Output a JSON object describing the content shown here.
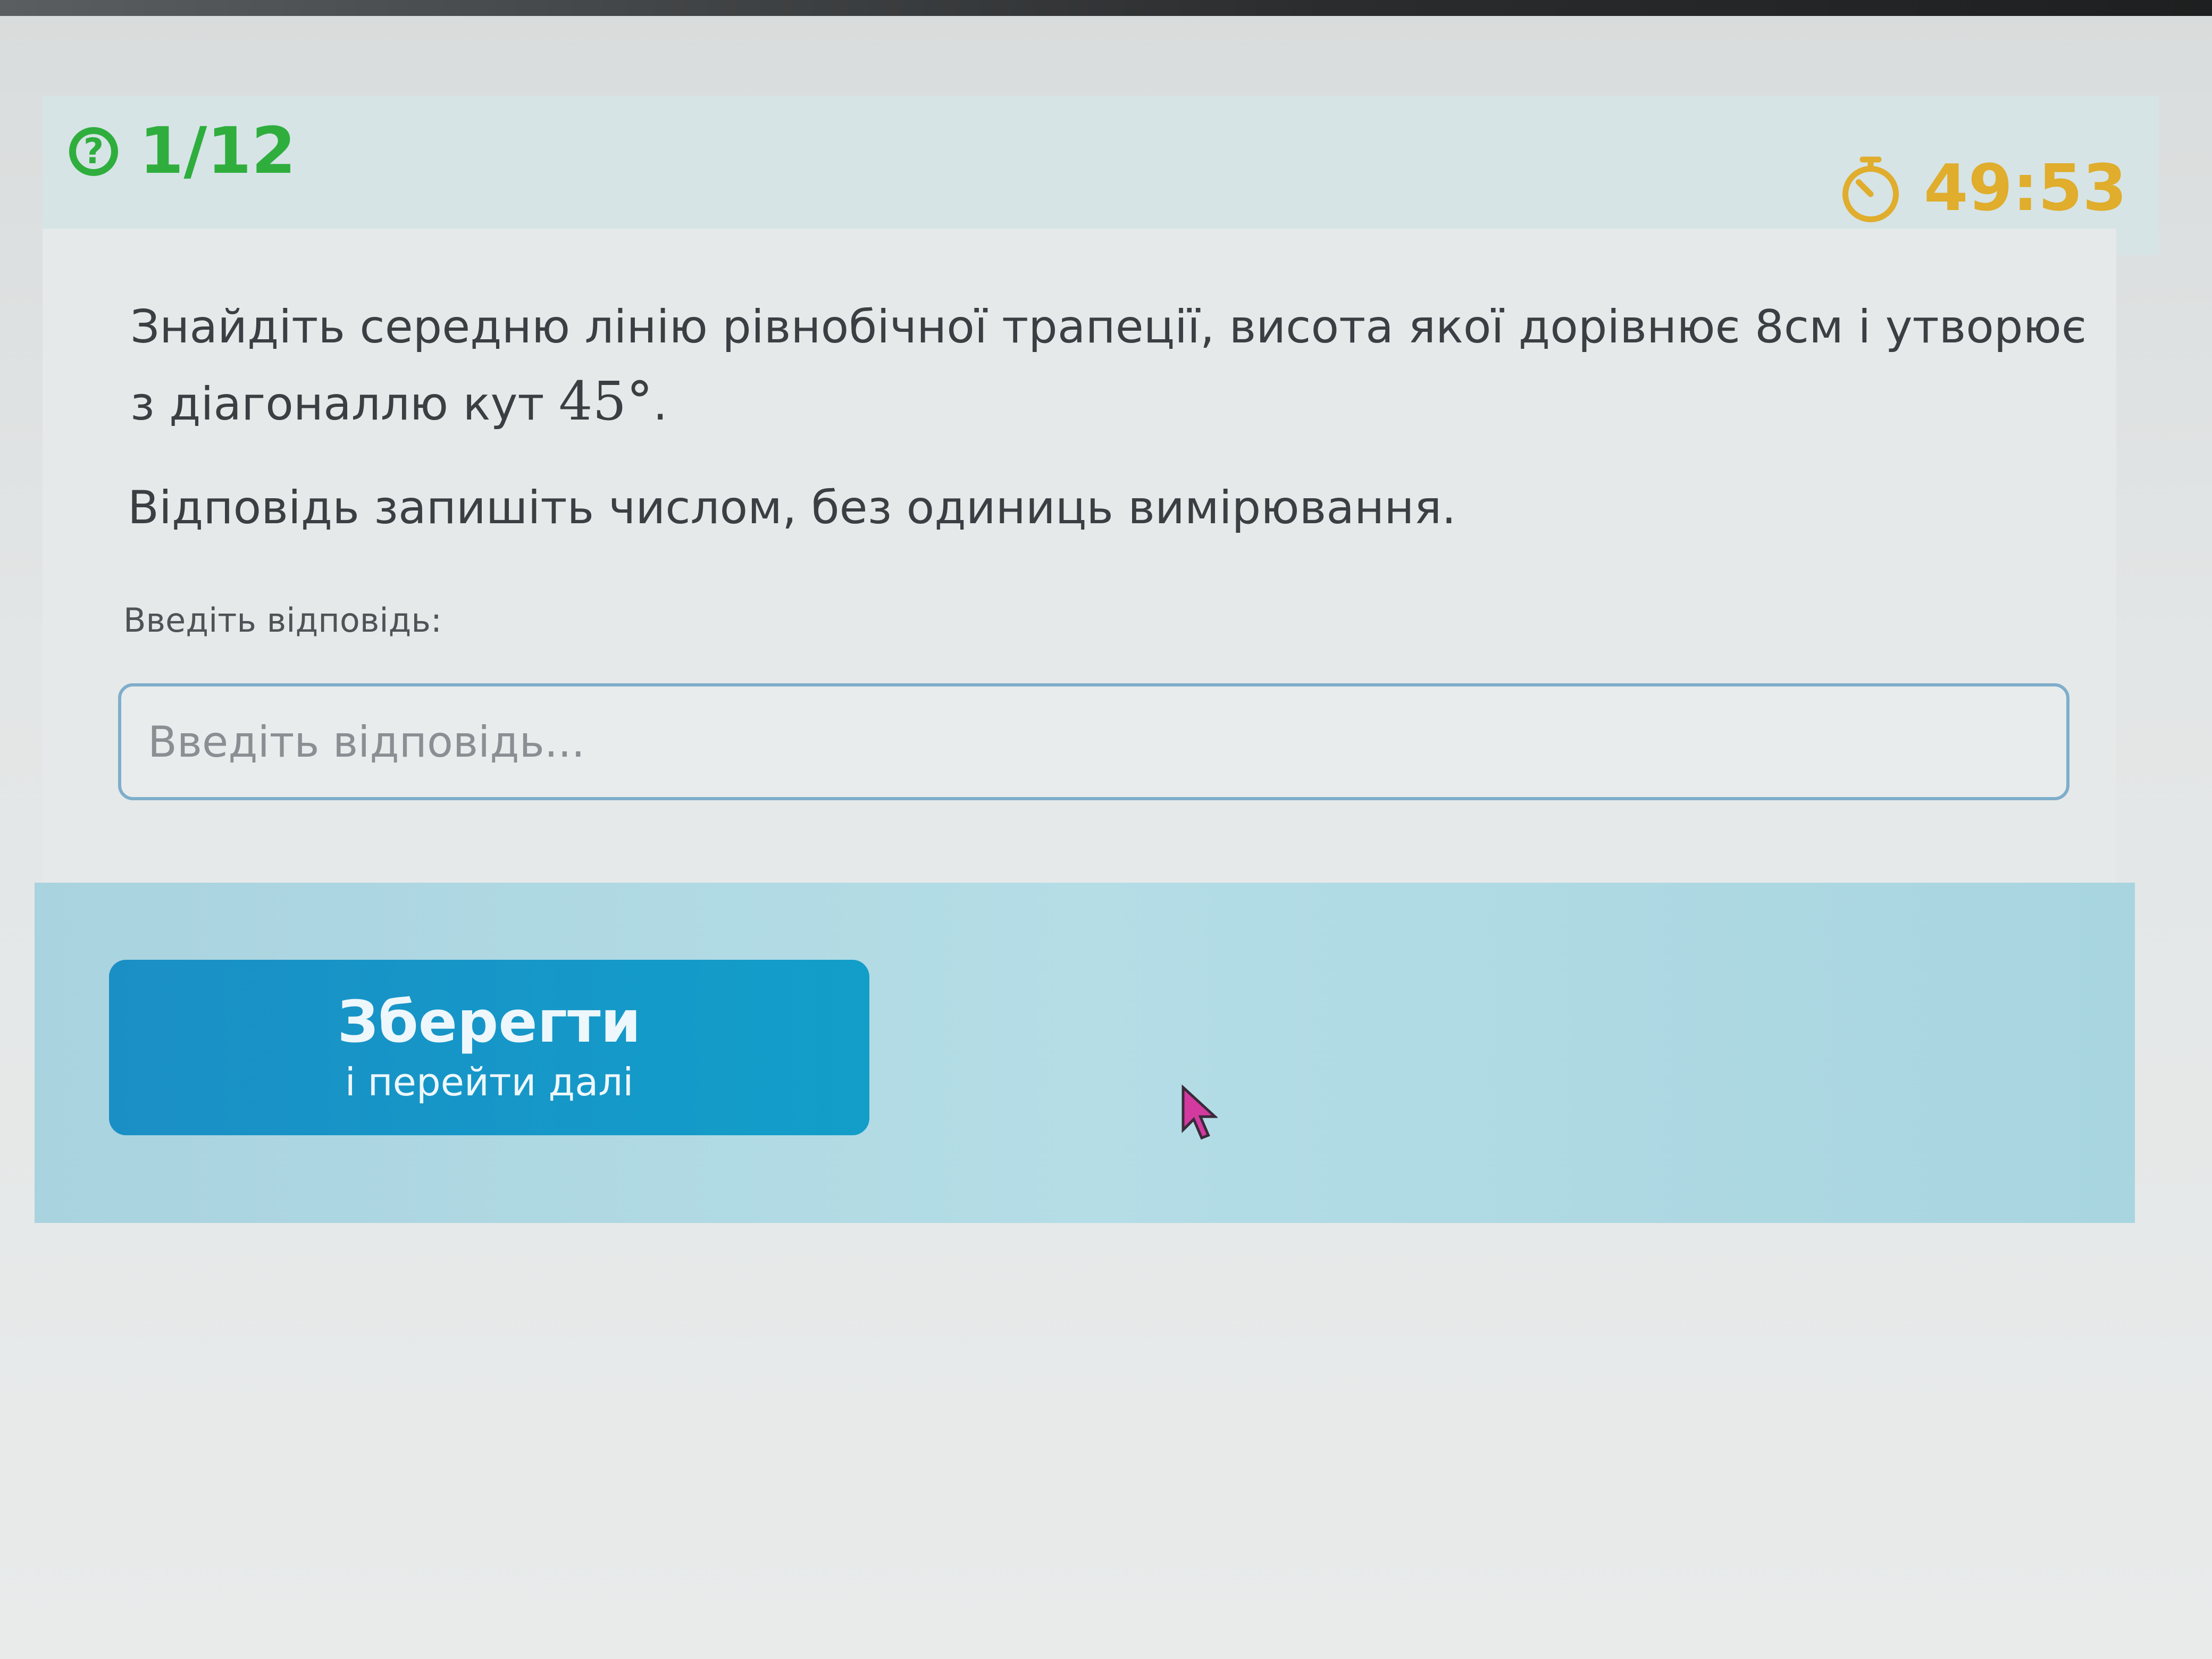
{
  "header": {
    "progress": "1/12",
    "progress_icon": "question-circle-icon",
    "timer": "49:53",
    "timer_icon": "stopwatch-icon"
  },
  "question": {
    "text_before": "Знайдіть середню лінію рівнобічної трапеції, висота якої дорівнює 8см і утворює з діагоналлю кут ",
    "math": "45°",
    "text_after": ".",
    "instruction": "Відповідь запишіть числом, без одиниць вимірювання."
  },
  "answer": {
    "label": "Введіть відповідь:",
    "placeholder": "Введіть відповідь...",
    "value": ""
  },
  "footer": {
    "save_label": "Зберегти",
    "save_sublabel": "і перейти далі"
  },
  "colors": {
    "progress": "#2fae3d",
    "timer": "#e0ad2c",
    "button": "#1a8fc6",
    "footer": "#b4dde6",
    "input_border": "#7eaecb"
  }
}
